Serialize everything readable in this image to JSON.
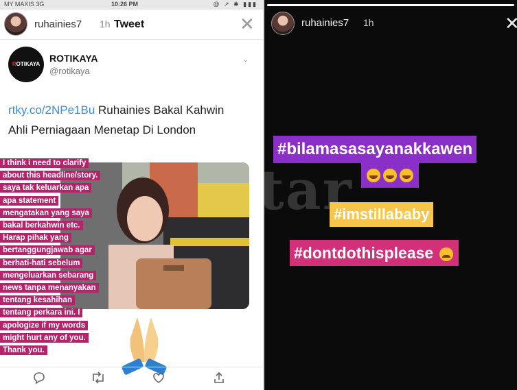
{
  "tweet_screen": {
    "status_bar": {
      "carrier": "MY MAXIS 3G",
      "time": "10:26 PM",
      "icons": "@ ↗ ✱ ▮▮▮"
    },
    "story_user": {
      "username": "ruhainies7",
      "age": "1h"
    },
    "screen_title": "Tweet",
    "author": {
      "logo_text": "ROTIKAYA",
      "name": "ROTIKAYA",
      "handle": "@rotikaya"
    },
    "tweet_link": "rtky.co/2NPe1Bu",
    "tweet_body": "Ruhainies Bakal Kahwin Ahli Perniagaan Menetap Di London",
    "caption_lines": [
      "I think i need to clarify",
      "about this headline/story.",
      "saya tak keluarkan apa",
      "apa statement",
      "mengatakan yang saya",
      "bakal berkahwin etc.",
      "Harap pihak yang",
      "bertanggungjawab agar",
      "berhati-hati sebelum",
      "mengeluarkan sebarang",
      "news tanpa menanyakan",
      "tentang kesahihan",
      "tentang perkara ini. I",
      "apologize if my words",
      "might hurt any of you.",
      "Thank you."
    ],
    "caption_bg_color": "#b3246a",
    "actions": [
      {
        "name": "reply-icon",
        "glyph": "◯"
      },
      {
        "name": "retweet-icon",
        "glyph": "⇄"
      },
      {
        "name": "like-icon",
        "glyph": "♡"
      },
      {
        "name": "share-icon",
        "glyph": "⇧"
      }
    ]
  },
  "story_screen": {
    "story_user": {
      "username": "ruhainies7",
      "age": "1h"
    },
    "watermark": "Star",
    "tags": [
      {
        "text": "#bilamasasayanakkawen",
        "color": "#8a2fc8"
      },
      {
        "text": "#imstillababy",
        "color": "#f5c64b"
      },
      {
        "text": "#dontdothisplease",
        "color": "#d3307a"
      }
    ]
  }
}
